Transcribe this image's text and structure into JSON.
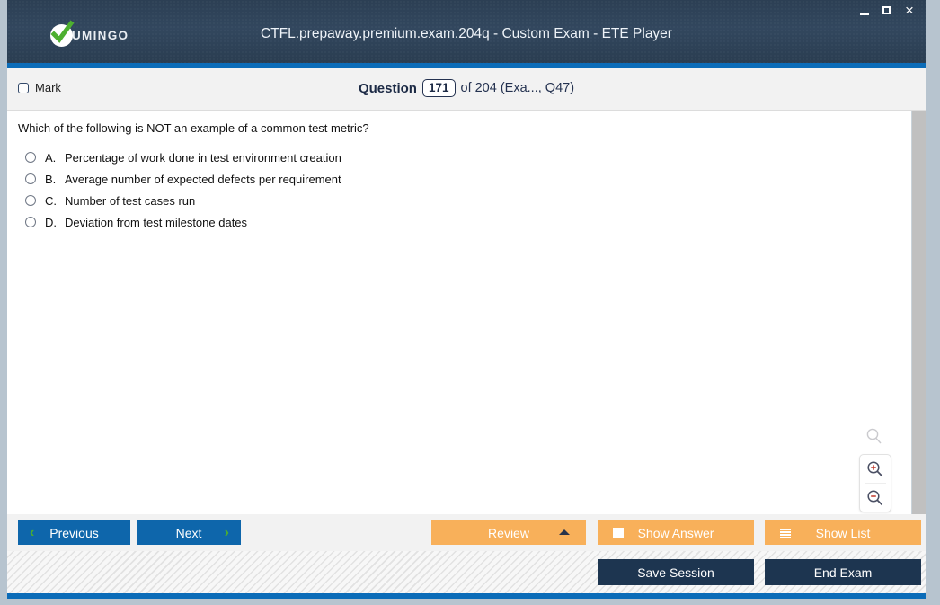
{
  "window": {
    "title": "CTFL.prepaway.premium.exam.204q - Custom Exam - ETE Player",
    "logo_text": "UMINGO",
    "controls": {
      "minimize": "minimize",
      "maximize": "maximize",
      "close": "×"
    },
    "colors": {
      "titlebar": "#2f4359",
      "accent": "#0b6cb8",
      "primary_button": "#0e66ab",
      "secondary_button": "#f8b05a",
      "dark_button": "#1d3550",
      "chevron_green": "#4caf2e"
    }
  },
  "header": {
    "mark_label_prefix": "",
    "mark_accel": "M",
    "mark_label_rest": "ark",
    "question_word": "Question",
    "question_number": "171",
    "of_text": "of 204 (Exa..., Q47)"
  },
  "question": {
    "text": "Which of the following is NOT an example of a common test metric?",
    "options": [
      {
        "letter": "A.",
        "text": "Percentage of work done in test environment creation",
        "selected": false
      },
      {
        "letter": "B.",
        "text": "Average number of expected defects per requirement",
        "selected": false
      },
      {
        "letter": "C.",
        "text": "Number of test cases run",
        "selected": false
      },
      {
        "letter": "D.",
        "text": "Deviation from test milestone dates",
        "selected": false
      }
    ]
  },
  "zoom_tools": {
    "pointer": "magnifier-icon",
    "zoom_in": "zoom-in-icon",
    "zoom_out": "zoom-out-icon"
  },
  "navbar": {
    "previous": "Previous",
    "next": "Next",
    "review": "Review",
    "show_answer": "Show Answer",
    "show_list": "Show List"
  },
  "footer": {
    "save_session": "Save Session",
    "end_exam": "End Exam"
  }
}
